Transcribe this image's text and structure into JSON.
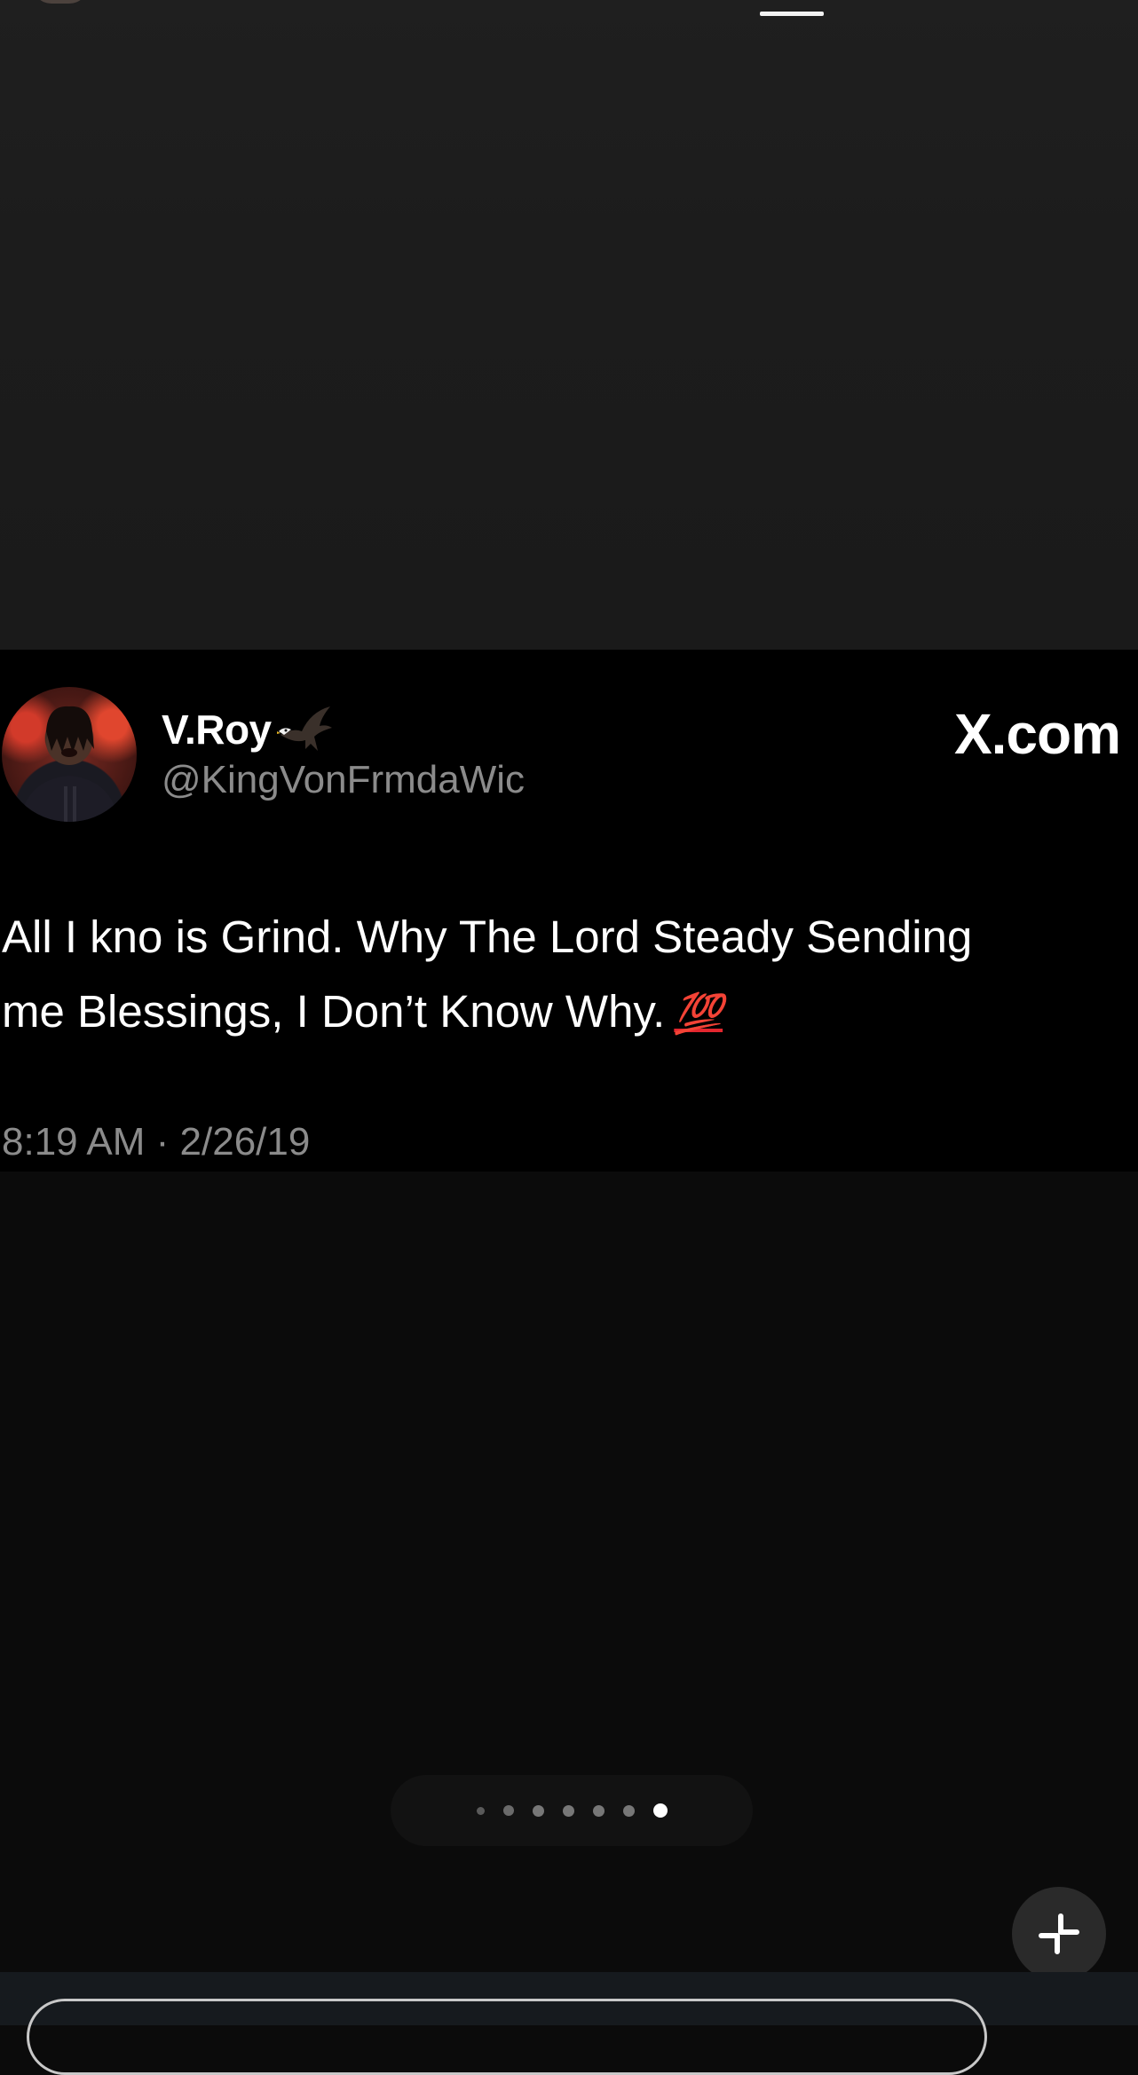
{
  "tweet": {
    "display_name": "V.Roy",
    "handle": "@KingVonFrmdaWic",
    "source": "X.com",
    "body_line1": "All I kno is Grind. Why The Lord Steady Sending",
    "body_line2": "me Blessings, I Don’t Know Why.",
    "emoji": "💯",
    "timestamp": "8:19 AM · 2/26/19"
  },
  "pager": {
    "total": 7,
    "active_index": 6
  },
  "icons": {
    "collapse": "collapse-fullscreen-icon",
    "emoji_name": "eagle-icon"
  },
  "colors": {
    "card_bg": "#000000",
    "handle_gray": "#8b8b8b",
    "emoji_red": "#e3262e"
  }
}
